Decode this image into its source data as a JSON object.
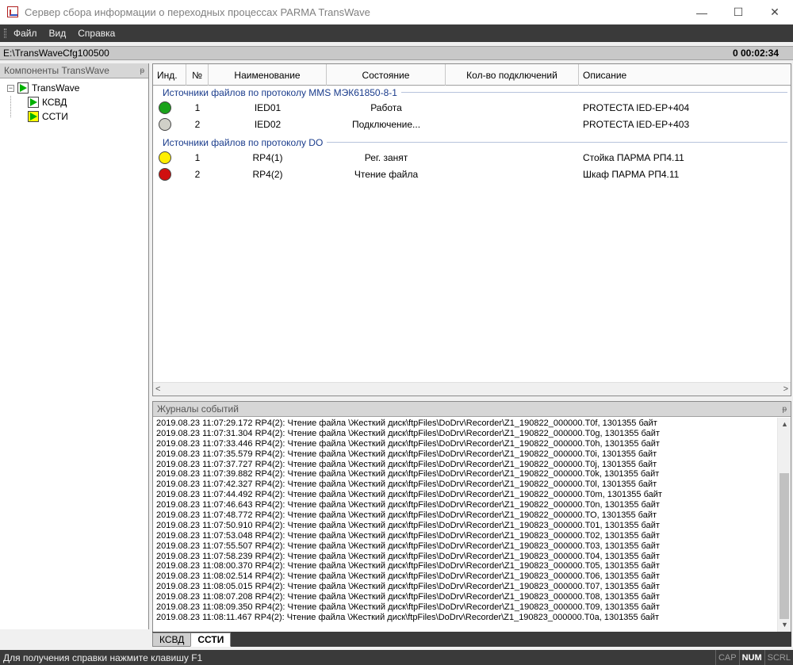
{
  "window": {
    "title": "Сервер сбора информации о переходных процессах PARMA TransWave",
    "buttons": {
      "minimize": "—",
      "maximize": "☐",
      "close": "✕"
    }
  },
  "menu": [
    "Файл",
    "Вид",
    "Справка"
  ],
  "pathbar": {
    "path": "E:\\TransWaveCfg100500",
    "timer": "0 00:02:34"
  },
  "components_panel": {
    "title": "Компоненты TransWave",
    "tree": {
      "root": {
        "label": "TransWave",
        "expander": "−"
      },
      "children": [
        {
          "label": "КСВД"
        },
        {
          "label": "ССТИ"
        }
      ]
    }
  },
  "grid": {
    "columns": [
      "Инд.",
      "№",
      "Наименование",
      "Состояние",
      "Кол-во подключений",
      "Описание"
    ],
    "groups": [
      {
        "title": "Источники файлов по протоколу MMS МЭК61850-8-1",
        "rows": [
          {
            "indicator": "#1aa31a",
            "num": "1",
            "name": "IED01",
            "state": "Работа",
            "connections": "",
            "description": "PROTECTA IED-EP+404"
          },
          {
            "indicator": "#d0d0c8",
            "num": "2",
            "name": "IED02",
            "state": "Подключение...",
            "connections": "",
            "description": "PROTECTA IED-EP+403"
          }
        ]
      },
      {
        "title": "Источники файлов по протоколу DO",
        "rows": [
          {
            "indicator": "#ffee00",
            "num": "1",
            "name": "RP4(1)",
            "state": "Рег. занят",
            "connections": "",
            "description": "Стойка ПАРМА РП4.11"
          },
          {
            "indicator": "#d01010",
            "num": "2",
            "name": "RP4(2)",
            "state": "Чтение файла",
            "connections": "",
            "description": "Шкаф ПАРМА РП4.11"
          }
        ]
      }
    ],
    "scroll_left": "<",
    "scroll_right": ">"
  },
  "log_panel": {
    "title": "Журналы событий",
    "lines": [
      "2019.08.23 11:07:29.172 RP4(2): Чтение файла \\Жесткий диск\\ftpFiles\\DoDrv\\Recorder\\Z1_190822_000000.T0f, 1301355 байт",
      "2019.08.23 11:07:31.304 RP4(2): Чтение файла \\Жесткий диск\\ftpFiles\\DoDrv\\Recorder\\Z1_190822_000000.T0g, 1301355 байт",
      "2019.08.23 11:07:33.446 RP4(2): Чтение файла \\Жесткий диск\\ftpFiles\\DoDrv\\Recorder\\Z1_190822_000000.T0h, 1301355 байт",
      "2019.08.23 11:07:35.579 RP4(2): Чтение файла \\Жесткий диск\\ftpFiles\\DoDrv\\Recorder\\Z1_190822_000000.T0i, 1301355 байт",
      "2019.08.23 11:07:37.727 RP4(2): Чтение файла \\Жесткий диск\\ftpFiles\\DoDrv\\Recorder\\Z1_190822_000000.T0j, 1301355 байт",
      "2019.08.23 11:07:39.882 RP4(2): Чтение файла \\Жесткий диск\\ftpFiles\\DoDrv\\Recorder\\Z1_190822_000000.T0k, 1301355 байт",
      "2019.08.23 11:07:42.327 RP4(2): Чтение файла \\Жесткий диск\\ftpFiles\\DoDrv\\Recorder\\Z1_190822_000000.T0l, 1301355 байт",
      "2019.08.23 11:07:44.492 RP4(2): Чтение файла \\Жесткий диск\\ftpFiles\\DoDrv\\Recorder\\Z1_190822_000000.T0m, 1301355 байт",
      "2019.08.23 11:07:46.643 RP4(2): Чтение файла \\Жесткий диск\\ftpFiles\\DoDrv\\Recorder\\Z1_190822_000000.T0n, 1301355 байт",
      "2019.08.23 11:07:48.772 RP4(2): Чтение файла \\Жесткий диск\\ftpFiles\\DoDrv\\Recorder\\Z1_190822_000000.TO, 1301355 байт",
      "2019.08.23 11:07:50.910 RP4(2): Чтение файла \\Жесткий диск\\ftpFiles\\DoDrv\\Recorder\\Z1_190823_000000.T01, 1301355 байт",
      "2019.08.23 11:07:53.048 RP4(2): Чтение файла \\Жесткий диск\\ftpFiles\\DoDrv\\Recorder\\Z1_190823_000000.T02, 1301355 байт",
      "2019.08.23 11:07:55.507 RP4(2): Чтение файла \\Жесткий диск\\ftpFiles\\DoDrv\\Recorder\\Z1_190823_000000.T03, 1301355 байт",
      "2019.08.23 11:07:58.239 RP4(2): Чтение файла \\Жесткий диск\\ftpFiles\\DoDrv\\Recorder\\Z1_190823_000000.T04, 1301355 байт",
      "2019.08.23 11:08:00.370 RP4(2): Чтение файла \\Жесткий диск\\ftpFiles\\DoDrv\\Recorder\\Z1_190823_000000.T05, 1301355 байт",
      "2019.08.23 11:08:02.514 RP4(2): Чтение файла \\Жесткий диск\\ftpFiles\\DoDrv\\Recorder\\Z1_190823_000000.T06, 1301355 байт",
      "2019.08.23 11:08:05.015 RP4(2): Чтение файла \\Жесткий диск\\ftpFiles\\DoDrv\\Recorder\\Z1_190823_000000.T07, 1301355 байт",
      "2019.08.23 11:08:07.208 RP4(2): Чтение файла \\Жесткий диск\\ftpFiles\\DoDrv\\Recorder\\Z1_190823_000000.T08, 1301355 байт",
      "2019.08.23 11:08:09.350 RP4(2): Чтение файла \\Жесткий диск\\ftpFiles\\DoDrv\\Recorder\\Z1_190823_000000.T09, 1301355 байт",
      "2019.08.23 11:08:11.467 RP4(2): Чтение файла \\Жесткий диск\\ftpFiles\\DoDrv\\Recorder\\Z1_190823_000000.T0a, 1301355 байт"
    ],
    "scroll_up": "▲",
    "scroll_down": "▼"
  },
  "bottom_tabs": [
    {
      "label": "КСВД",
      "active": false
    },
    {
      "label": "ССТИ",
      "active": true
    }
  ],
  "statusbar": {
    "text": "Для получения справки нажмите клавишу F1",
    "indicators": [
      {
        "label": "CAP",
        "on": false
      },
      {
        "label": "NUM",
        "on": true
      },
      {
        "label": "SCRL",
        "on": false
      }
    ]
  },
  "pin_glyph": "ᵽ"
}
